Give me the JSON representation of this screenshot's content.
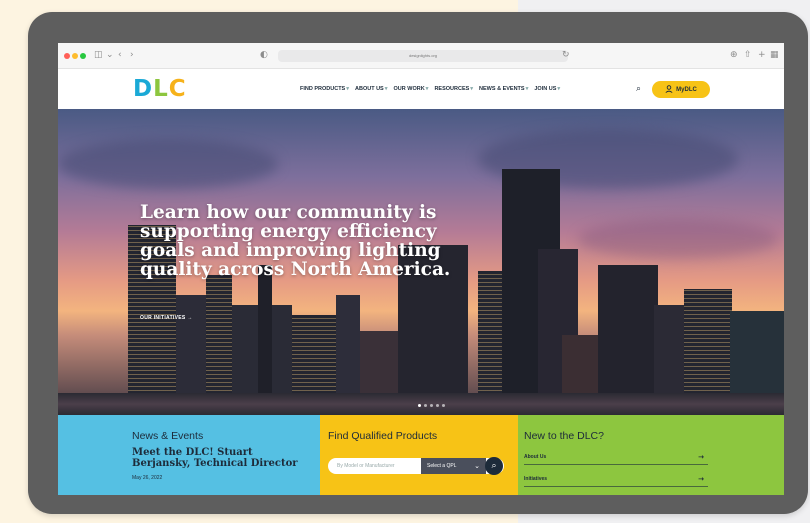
{
  "browser": {
    "url": "designlights.org",
    "icons": [
      "sidebar-icon",
      "chevron-left-icon",
      "chevron-right-icon",
      "shield-icon",
      "reload-icon",
      "download-icon",
      "share-icon",
      "plus-icon",
      "tabs-icon"
    ]
  },
  "logo": {
    "text_parts": [
      "D",
      "L",
      "C"
    ]
  },
  "nav": {
    "items": [
      "FIND PRODUCTS",
      "ABOUT US",
      "OUR WORK",
      "RESOURCES",
      "NEWS & EVENTS",
      "JOIN US"
    ],
    "mydlc_label": "MyDLC"
  },
  "hero": {
    "heading": "Learn how our community is supporting energy efficiency goals and improving lighting quality across North America.",
    "link_label": "OUR INITIATIVES"
  },
  "news": {
    "title": "News & Events",
    "headline": "Meet the DLC! Stuart Berjansky, Technical Director",
    "date": "May 26, 2022"
  },
  "find": {
    "title": "Find Qualified Products",
    "search_placeholder": "By Model or Manufacturer",
    "select_value": "Select a QPL"
  },
  "newto": {
    "title": "New to the DLC?",
    "items": [
      "About Us",
      "Initiatives"
    ]
  },
  "colors": {
    "background": "#fdf4e1",
    "device": "#5e5e5e",
    "accent_yellow": "#f7c316",
    "accent_blue": "#55c0e3",
    "accent_green": "#8dc63f",
    "navy": "#1d2b3a"
  }
}
